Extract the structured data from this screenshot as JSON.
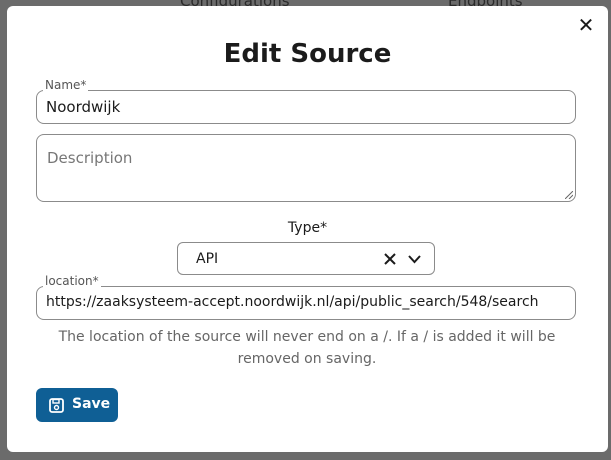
{
  "backdrop": {
    "left_text": "Configurations",
    "right_text": "Endpoints"
  },
  "modal": {
    "title": "Edit Source",
    "close_symbol": "✕",
    "name": {
      "label": "Name*",
      "value": "Noordwijk"
    },
    "description": {
      "placeholder": "Description",
      "value": ""
    },
    "type": {
      "label": "Type*",
      "selected": "API",
      "clear_symbol": "✕",
      "chevron": "chevron-down-icon"
    },
    "location": {
      "label": "location*",
      "value": "https://zaaksysteem-accept.noordwijk.nl/api/public_search/548/search"
    },
    "help_text_line1": "The location of the source will never end on a /. If a / is added it will be",
    "help_text_line2": "removed on saving.",
    "save_button": {
      "label": "Save",
      "icon": "floppy-disk-icon"
    }
  },
  "colors": {
    "accent": "#0f5f95",
    "overlay": "#6b6b6b",
    "border": "#8b8b8b"
  }
}
